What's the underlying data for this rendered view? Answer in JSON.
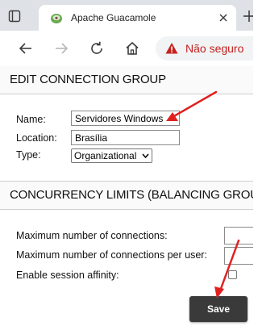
{
  "browser": {
    "tab_title": "Apache Guacamole",
    "security_label": "Não seguro",
    "colors": {
      "warning": "#c5221f",
      "tabstrip": "#dee1e6"
    }
  },
  "edit_section": {
    "title": "EDIT CONNECTION GROUP",
    "name_label": "Name:",
    "name_value": "Servidores Windows",
    "location_label": "Location:",
    "location_value": "Brasília",
    "type_label": "Type:",
    "type_value": "Organizational"
  },
  "concurrency_section": {
    "title": "CONCURRENCY LIMITS (BALANCING GROUPS)",
    "max_connections_label": "Maximum number of connections:",
    "max_connections_per_user_label": "Maximum number of connections per user:",
    "session_affinity_label": "Enable session affinity:"
  },
  "actions": {
    "save_label": "Save"
  },
  "annotations": {
    "arrow_color": "#e02020",
    "icons": [
      "tab-actions-icon",
      "guacamole-favicon",
      "close-icon",
      "plus-icon",
      "back-arrow-icon",
      "forward-arrow-icon",
      "reload-icon",
      "home-icon",
      "warning-icon",
      "chevron-down-icon"
    ]
  }
}
